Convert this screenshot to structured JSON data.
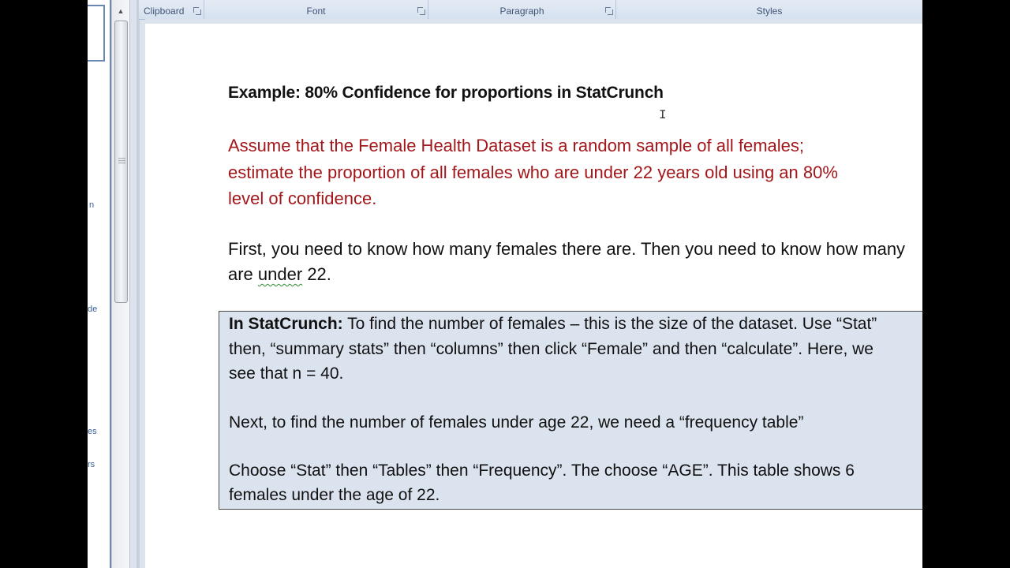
{
  "ribbon": {
    "groups": [
      {
        "label": "Clipboard"
      },
      {
        "label": "Font"
      },
      {
        "label": "Paragraph"
      },
      {
        "label": "Styles"
      }
    ]
  },
  "nav_pane": {
    "fragments": [
      "n",
      "de",
      "es",
      "rs"
    ]
  },
  "document": {
    "title": "Example: 80% Confidence for proportions in StatCrunch",
    "problem_lines": [
      "Assume that the Female Health Dataset is a random sample of all females;",
      "estimate the proportion of all females who are under 22 years old using an 80%",
      "level of confidence."
    ],
    "intro_lines": {
      "line1": "First, you need to know how many females there are. Then you need to know how many",
      "line2_prefix": "are ",
      "line2_squiggle": "under",
      "line2_suffix": " 22."
    },
    "box": {
      "label": "In StatCrunch:",
      "line1_rest": "  To find the number of females – this is the size of the dataset. Use “Stat”",
      "line2": "then, “summary stats” then “columns” then click “Female” and then “calculate”. Here, we",
      "line3": "see that n = 40.",
      "line4": "Next, to find the number of females under age 22, we need a “frequency table”",
      "line5": "Choose “Stat” then “Tables” then “Frequency”. The choose “AGE”. This table shows 6",
      "line6": "females under the age of 22."
    }
  }
}
